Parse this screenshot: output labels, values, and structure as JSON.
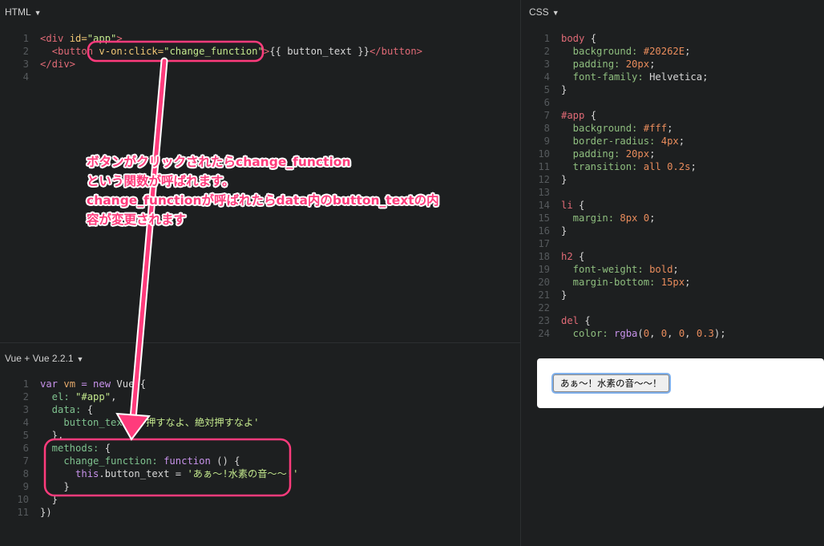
{
  "panes": {
    "html": {
      "title": "HTML"
    },
    "css": {
      "title": "CSS"
    },
    "js": {
      "title": "Vue + Vue 2.2.1"
    }
  },
  "html_code": [
    [
      [
        "tag",
        "<div "
      ],
      [
        "attr",
        "id="
      ],
      [
        "str",
        "\"app\""
      ],
      [
        "tag",
        ">"
      ]
    ],
    [
      [
        "plain",
        "  "
      ],
      [
        "tag",
        "<button "
      ],
      [
        "attr",
        "v-on:click="
      ],
      [
        "str",
        "\"change_function\""
      ],
      [
        "tag",
        ">"
      ],
      [
        "txt",
        "{{ button_text }}"
      ],
      [
        "tag",
        "</button>"
      ]
    ],
    [
      [
        "tag",
        "</div>"
      ]
    ],
    []
  ],
  "css_code": [
    [
      [
        "sel",
        "body "
      ],
      [
        "punc",
        "{"
      ]
    ],
    [
      [
        "prop",
        "  background: "
      ],
      [
        "num",
        "#20262E"
      ],
      [
        "punc",
        ";"
      ]
    ],
    [
      [
        "prop",
        "  padding: "
      ],
      [
        "num",
        "20px"
      ],
      [
        "punc",
        ";"
      ]
    ],
    [
      [
        "prop",
        "  font-family: "
      ],
      [
        "plain",
        "Helvetica"
      ],
      [
        "punc",
        ";"
      ]
    ],
    [
      [
        "punc",
        "}"
      ]
    ],
    [],
    [
      [
        "sel",
        "#app "
      ],
      [
        "punc",
        "{"
      ]
    ],
    [
      [
        "prop",
        "  background: "
      ],
      [
        "num",
        "#fff"
      ],
      [
        "punc",
        ";"
      ]
    ],
    [
      [
        "prop",
        "  border-radius: "
      ],
      [
        "num",
        "4px"
      ],
      [
        "punc",
        ";"
      ]
    ],
    [
      [
        "prop",
        "  padding: "
      ],
      [
        "num",
        "20px"
      ],
      [
        "punc",
        ";"
      ]
    ],
    [
      [
        "prop",
        "  transition: "
      ],
      [
        "num",
        "all"
      ],
      [
        "plain",
        " "
      ],
      [
        "num",
        "0.2s"
      ],
      [
        "punc",
        ";"
      ]
    ],
    [
      [
        "punc",
        "}"
      ]
    ],
    [],
    [
      [
        "sel",
        "li "
      ],
      [
        "punc",
        "{"
      ]
    ],
    [
      [
        "prop",
        "  margin: "
      ],
      [
        "num",
        "8px"
      ],
      [
        "plain",
        " "
      ],
      [
        "num",
        "0"
      ],
      [
        "punc",
        ";"
      ]
    ],
    [
      [
        "punc",
        "}"
      ]
    ],
    [],
    [
      [
        "sel",
        "h2 "
      ],
      [
        "punc",
        "{"
      ]
    ],
    [
      [
        "prop",
        "  font-weight: "
      ],
      [
        "num",
        "bold"
      ],
      [
        "punc",
        ";"
      ]
    ],
    [
      [
        "prop",
        "  margin-bottom: "
      ],
      [
        "num",
        "15px"
      ],
      [
        "punc",
        ";"
      ]
    ],
    [
      [
        "punc",
        "}"
      ]
    ],
    [],
    [
      [
        "sel",
        "del "
      ],
      [
        "punc",
        "{"
      ]
    ],
    [
      [
        "prop",
        "  color: "
      ],
      [
        "kw",
        "rgba"
      ],
      [
        "punc",
        "("
      ],
      [
        "num",
        "0"
      ],
      [
        "punc",
        ", "
      ],
      [
        "num",
        "0"
      ],
      [
        "punc",
        ", "
      ],
      [
        "num",
        "0"
      ],
      [
        "punc",
        ", "
      ],
      [
        "num",
        "0.3"
      ],
      [
        "punc",
        ");"
      ]
    ]
  ],
  "js_code": [
    [
      [
        "kw",
        "var "
      ],
      [
        "var",
        "vm "
      ],
      [
        "kw",
        "= new "
      ],
      [
        "plain",
        "Vue({"
      ]
    ],
    [
      [
        "key",
        "  el: "
      ],
      [
        "str",
        "\"#app\""
      ],
      [
        "punc",
        ","
      ]
    ],
    [
      [
        "key",
        "  data: "
      ],
      [
        "punc",
        "{"
      ]
    ],
    [
      [
        "key",
        "    button_text: "
      ],
      [
        "str",
        "'押すなよ、絶対押すなよ'"
      ]
    ],
    [
      [
        "punc",
        "  },"
      ]
    ],
    [
      [
        "key",
        "  methods: "
      ],
      [
        "punc",
        "{"
      ]
    ],
    [
      [
        "key",
        "    change_function: "
      ],
      [
        "kw",
        "function "
      ],
      [
        "punc",
        "() {"
      ]
    ],
    [
      [
        "kw",
        "      this"
      ],
      [
        "plain",
        ".button_text = "
      ],
      [
        "str",
        "'あぁ〜!水素の音〜〜!'"
      ]
    ],
    [
      [
        "punc",
        "    }"
      ]
    ],
    [
      [
        "punc",
        "  }"
      ]
    ],
    [
      [
        "punc",
        "})"
      ]
    ]
  ],
  "result": {
    "button_label": "あぁ〜！水素の音〜〜！"
  },
  "annotation": {
    "lines": [
      "ボタンがクリックされたらchange_function",
      "という関数が呼ばれます。",
      "change_functionが呼ばれたらdata内のbutton_textの内",
      "容が変更されます"
    ]
  },
  "colors": {
    "annotation": "#ff3b7c",
    "background": "#1d1f20"
  }
}
